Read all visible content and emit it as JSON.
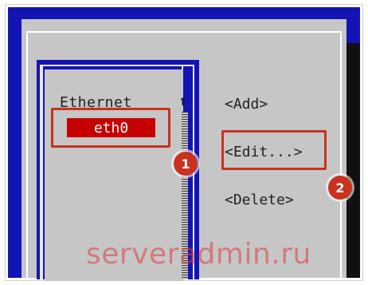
{
  "list": {
    "title": "Ethernet",
    "scroll_up_glyph": "↑",
    "items": [
      {
        "label": "eth0",
        "selected": true
      }
    ]
  },
  "buttons": {
    "add": "<Add>",
    "edit": "<Edit...>",
    "delete": "<Delete>"
  },
  "annotations": {
    "badge_1": "1",
    "badge_2": "2"
  },
  "watermark": "serveradmin.ru",
  "colors": {
    "terminal_bg": "#1414b4",
    "dialog_bg": "#c6c6c6",
    "selection_bg": "#c60000",
    "highlight": "#c8321e"
  }
}
